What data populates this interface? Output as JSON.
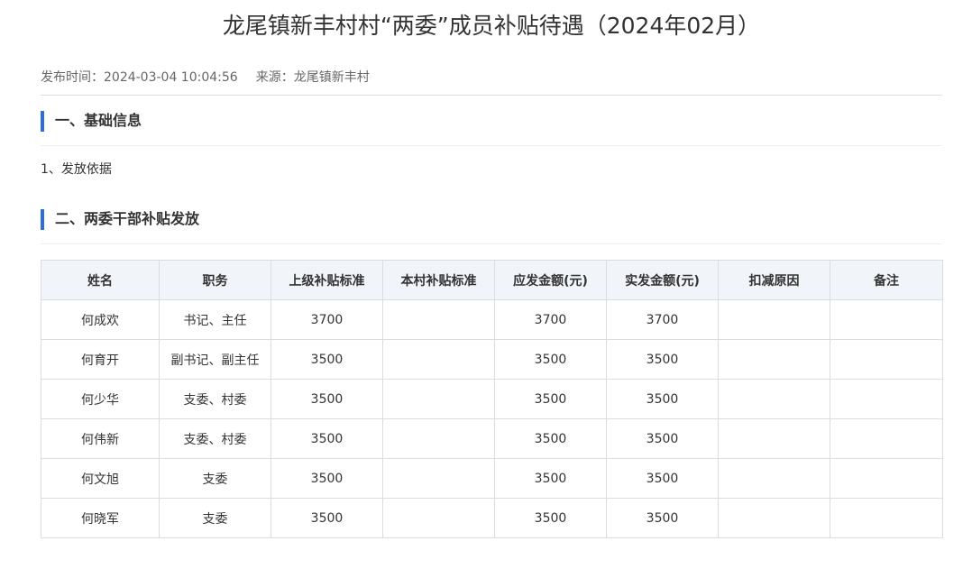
{
  "title": "龙尾镇新丰村村“两委”成员补贴待遇（2024年02月）",
  "meta": {
    "publish_time": "发布时间：2024-03-04 10:04:56",
    "source": "来源：龙尾镇新丰村"
  },
  "section1": {
    "heading": "一、基础信息",
    "paragraph": "1、发放依据"
  },
  "section2": {
    "heading": "二、两委干部补贴发放"
  },
  "table": {
    "headers": [
      "姓名",
      "职务",
      "上级补贴标准",
      "本村补贴标准",
      "应发金额(元)",
      "实发金额(元)",
      "扣减原因",
      "备注"
    ],
    "rows": [
      [
        "何成欢",
        "书记、主任",
        "3700",
        "",
        "3700",
        "3700",
        "",
        ""
      ],
      [
        "何育开",
        "副书记、副主任",
        "3500",
        "",
        "3500",
        "3500",
        "",
        ""
      ],
      [
        "何少华",
        "支委、村委",
        "3500",
        "",
        "3500",
        "3500",
        "",
        ""
      ],
      [
        "何伟新",
        "支委、村委",
        "3500",
        "",
        "3500",
        "3500",
        "",
        ""
      ],
      [
        "何文旭",
        "支委",
        "3500",
        "",
        "3500",
        "3500",
        "",
        ""
      ],
      [
        "何晓军",
        "支委",
        "3500",
        "",
        "3500",
        "3500",
        "",
        ""
      ]
    ]
  }
}
